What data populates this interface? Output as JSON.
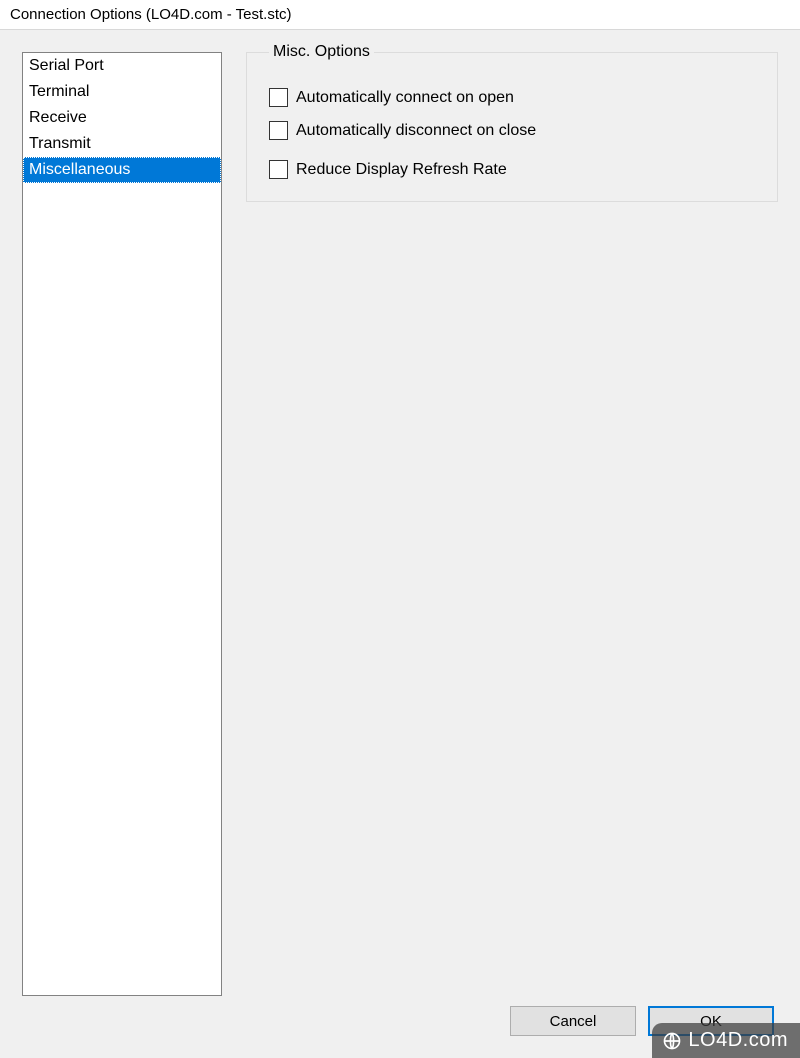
{
  "window": {
    "title": "Connection Options (LO4D.com - Test.stc)"
  },
  "sidebar": {
    "items": [
      {
        "label": "Serial Port",
        "selected": false
      },
      {
        "label": "Terminal",
        "selected": false
      },
      {
        "label": "Receive",
        "selected": false
      },
      {
        "label": "Transmit",
        "selected": false
      },
      {
        "label": "Miscellaneous",
        "selected": true
      }
    ]
  },
  "panel": {
    "legend": "Misc. Options",
    "options": [
      {
        "label": "Automatically connect on open",
        "checked": false
      },
      {
        "label": "Automatically disconnect on close",
        "checked": false
      },
      {
        "label": "Reduce Display Refresh Rate",
        "checked": false
      }
    ]
  },
  "buttons": {
    "cancel": "Cancel",
    "ok": "OK"
  },
  "watermark": {
    "text": "LO4D.com"
  }
}
